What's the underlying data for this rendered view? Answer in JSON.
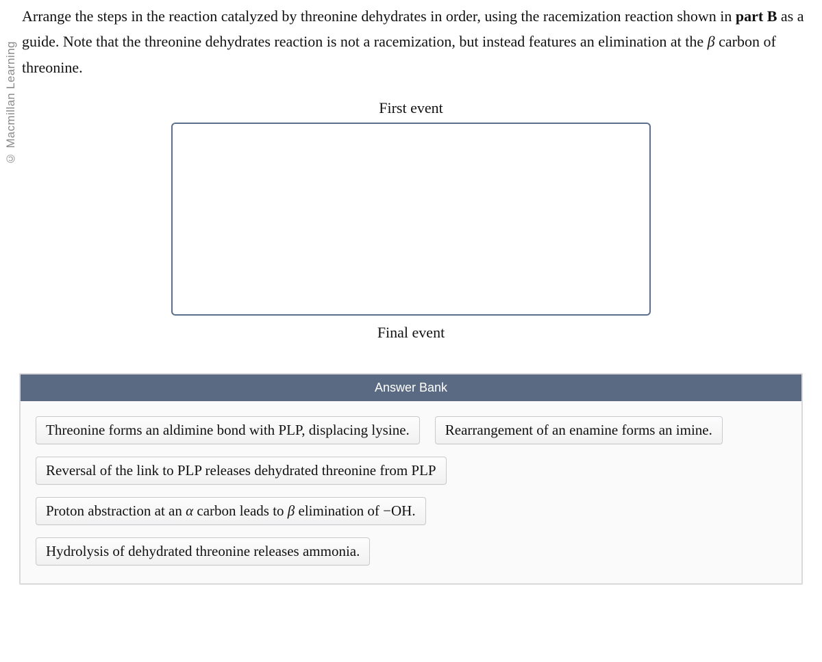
{
  "copyright": "© Macmillan Learning",
  "question": {
    "p1a": "Arrange the steps in the reaction catalyzed by threonine dehydrates in order, using the racemization reaction shown in ",
    "p1b": "part B",
    "p1c": " as a guide. Note that the threonine dehydrates reaction is not a racemization, but instead features an elimination at the ",
    "p1d": "β",
    "p1e": " carbon of threonine."
  },
  "labels": {
    "first": "First event",
    "final": "Final event",
    "bank": "Answer Bank"
  },
  "chips": {
    "c1": "Threonine forms an aldimine bond with PLP, displacing lysine.",
    "c2": "Rearrangement of an enamine forms an imine.",
    "c3": "Reversal of the link to PLP releases dehydrated threonine from PLP",
    "c4a": "Proton abstraction at an ",
    "c4b": "α",
    "c4c": " carbon leads to ",
    "c4d": "β",
    "c4e": " elimination of −OH.",
    "c5": "Hydrolysis of dehydrated threonine releases ammonia."
  }
}
